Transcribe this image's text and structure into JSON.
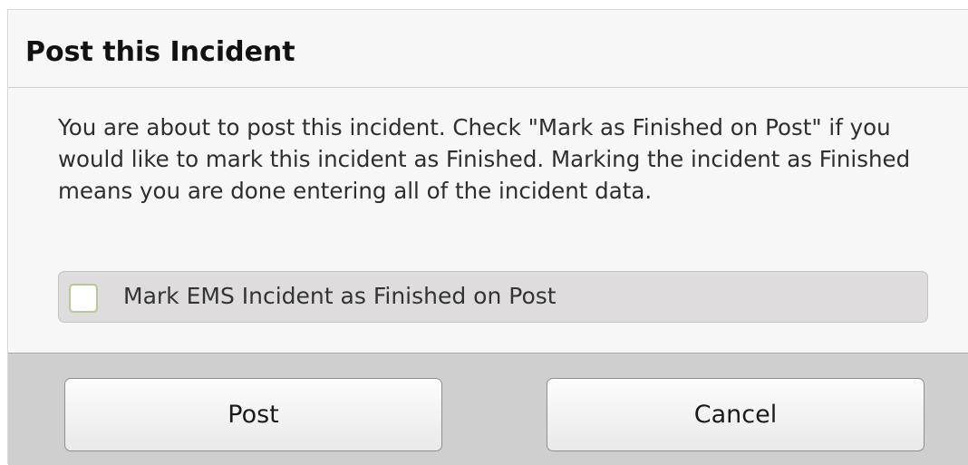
{
  "dialog": {
    "title": "Post this Incident",
    "message": "You are about to post this incident. Check \"Mark as Finished on Post\" if you would like to mark this incident as Finished. Marking the incident as Finished means you are done entering all of the incident data.",
    "checkbox": {
      "label": "Mark EMS Incident as Finished on Post",
      "checked": false
    },
    "buttons": {
      "post_label": "Post",
      "cancel_label": "Cancel"
    }
  },
  "colors": {
    "footer_bg": "#cfcfcf",
    "checkbox_row_bg": "#dedcdc",
    "checkbox_border": "#b6c79a"
  }
}
